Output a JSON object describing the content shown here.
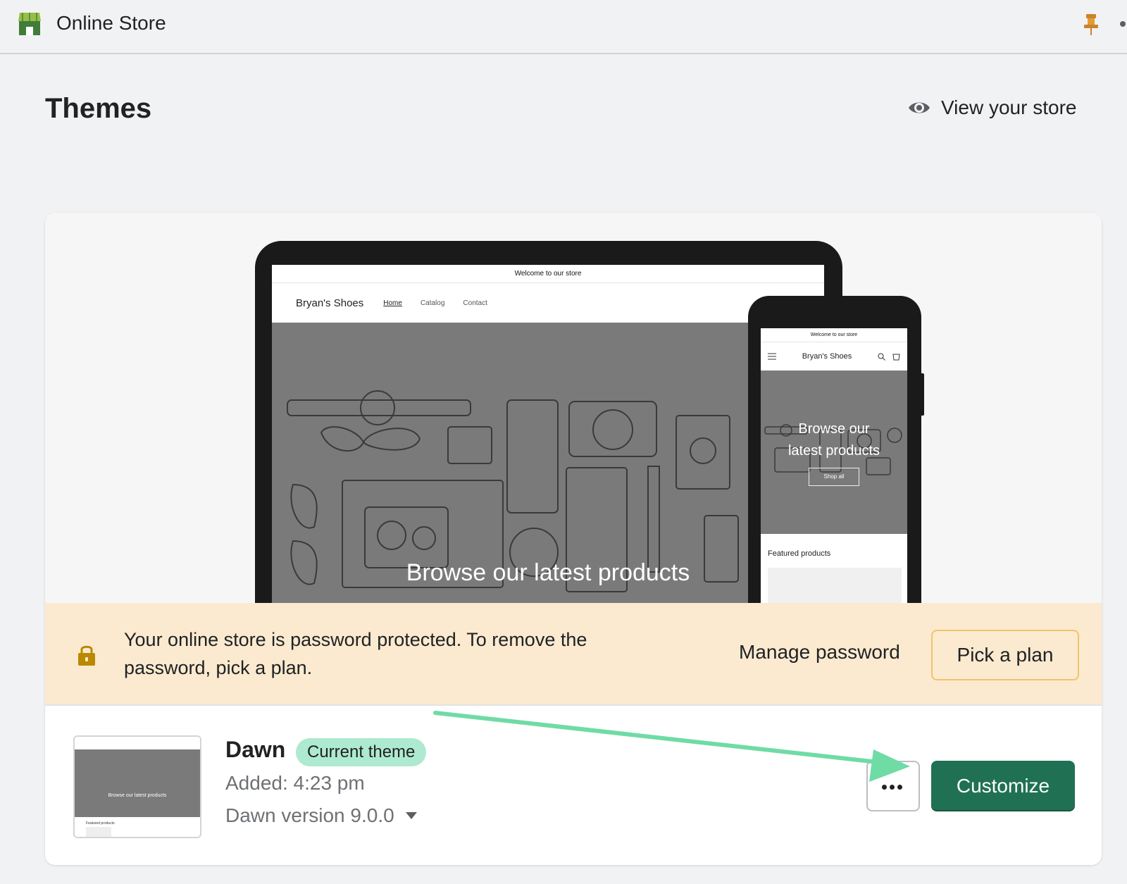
{
  "topbar": {
    "title": "Online Store",
    "icons": [
      "store-icon",
      "pin-icon"
    ]
  },
  "header": {
    "title": "Themes",
    "view_store": "View your store"
  },
  "preview": {
    "laptop": {
      "announcement": "Welcome to our store",
      "brand": "Bryan's Shoes",
      "nav": [
        "Home",
        "Catalog",
        "Contact"
      ],
      "hero_text": "Browse our latest products"
    },
    "phone": {
      "announcement": "Welcome to our store",
      "brand": "Bryan's Shoes",
      "hero_line1": "Browse our",
      "hero_line2": "latest products",
      "hero_button": "Shop all",
      "featured": "Featured products"
    }
  },
  "banner": {
    "message": "Your online store is password protected. To remove the password, pick a plan.",
    "manage_password": "Manage password",
    "pick_plan": "Pick a plan",
    "accent_color": "#fbead0"
  },
  "theme": {
    "name": "Dawn",
    "badge": "Current theme",
    "added": "Added: 4:23 pm",
    "version": "Dawn version 9.0.0",
    "thumb_text": "Browse our latest products",
    "thumb_featured": "Featured products",
    "customize": "Customize",
    "primary_color": "#207154",
    "badge_color": "#aee9d1"
  }
}
